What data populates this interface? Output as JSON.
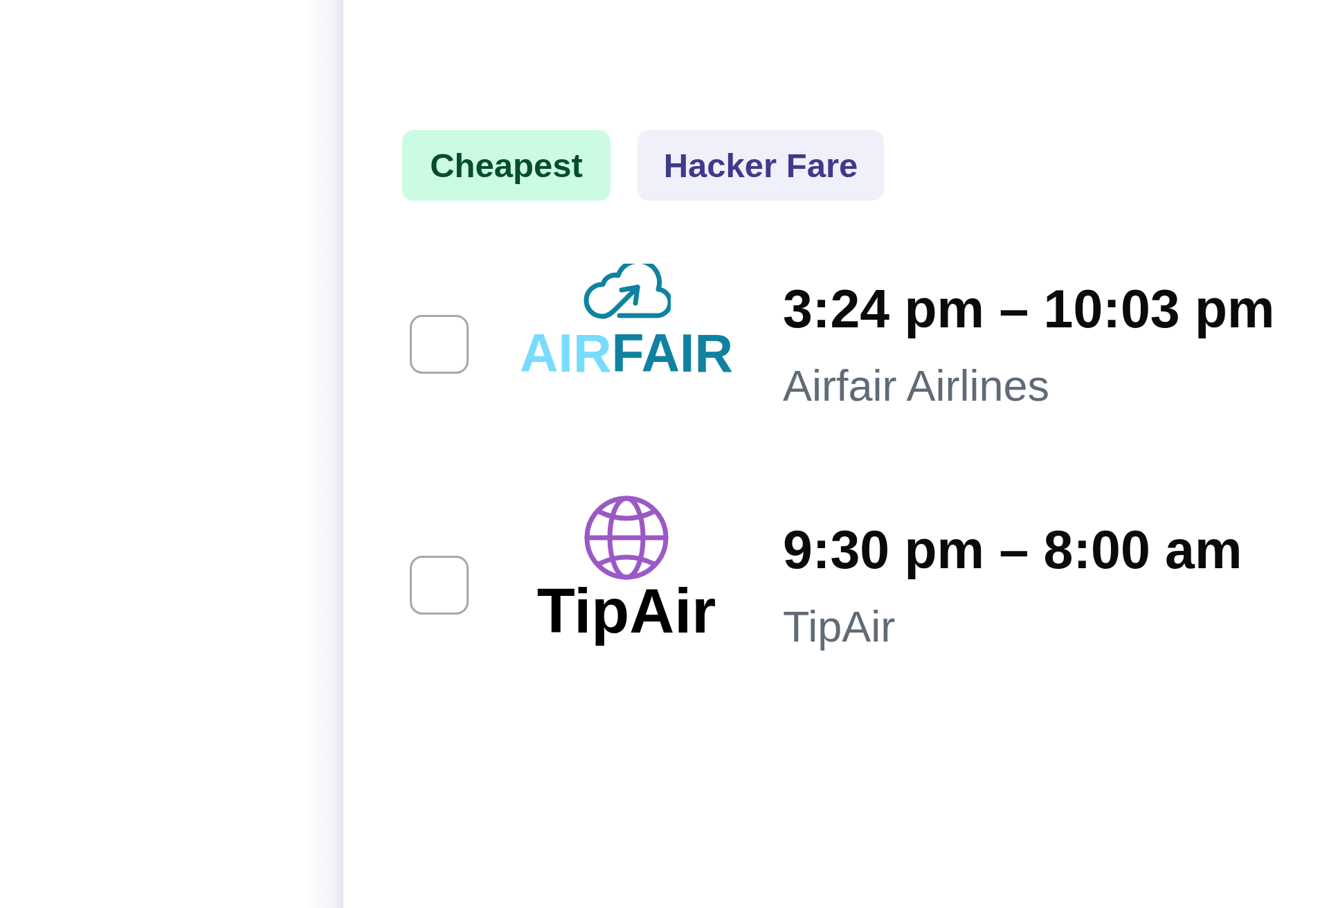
{
  "tags": [
    {
      "label": "Cheapest",
      "kind": "positive"
    },
    {
      "label": "Hacker Fare",
      "kind": "neutral"
    }
  ],
  "flights": [
    {
      "checked": false,
      "logo": {
        "kind": "cloud",
        "wordmark": [
          {
            "text": "AIR",
            "color": "#78dcfe"
          },
          {
            "text": "FAIR",
            "color": "#0e82a0"
          }
        ]
      },
      "times": "3:24 pm – 10:03 pm",
      "airline": "Airfair Airlines"
    },
    {
      "checked": false,
      "logo": {
        "kind": "globe",
        "wordmark": [
          {
            "text": "TipAir",
            "color": "#000000"
          }
        ]
      },
      "times": "9:30 pm – 8:00 am",
      "airline": "TipAir"
    }
  ]
}
